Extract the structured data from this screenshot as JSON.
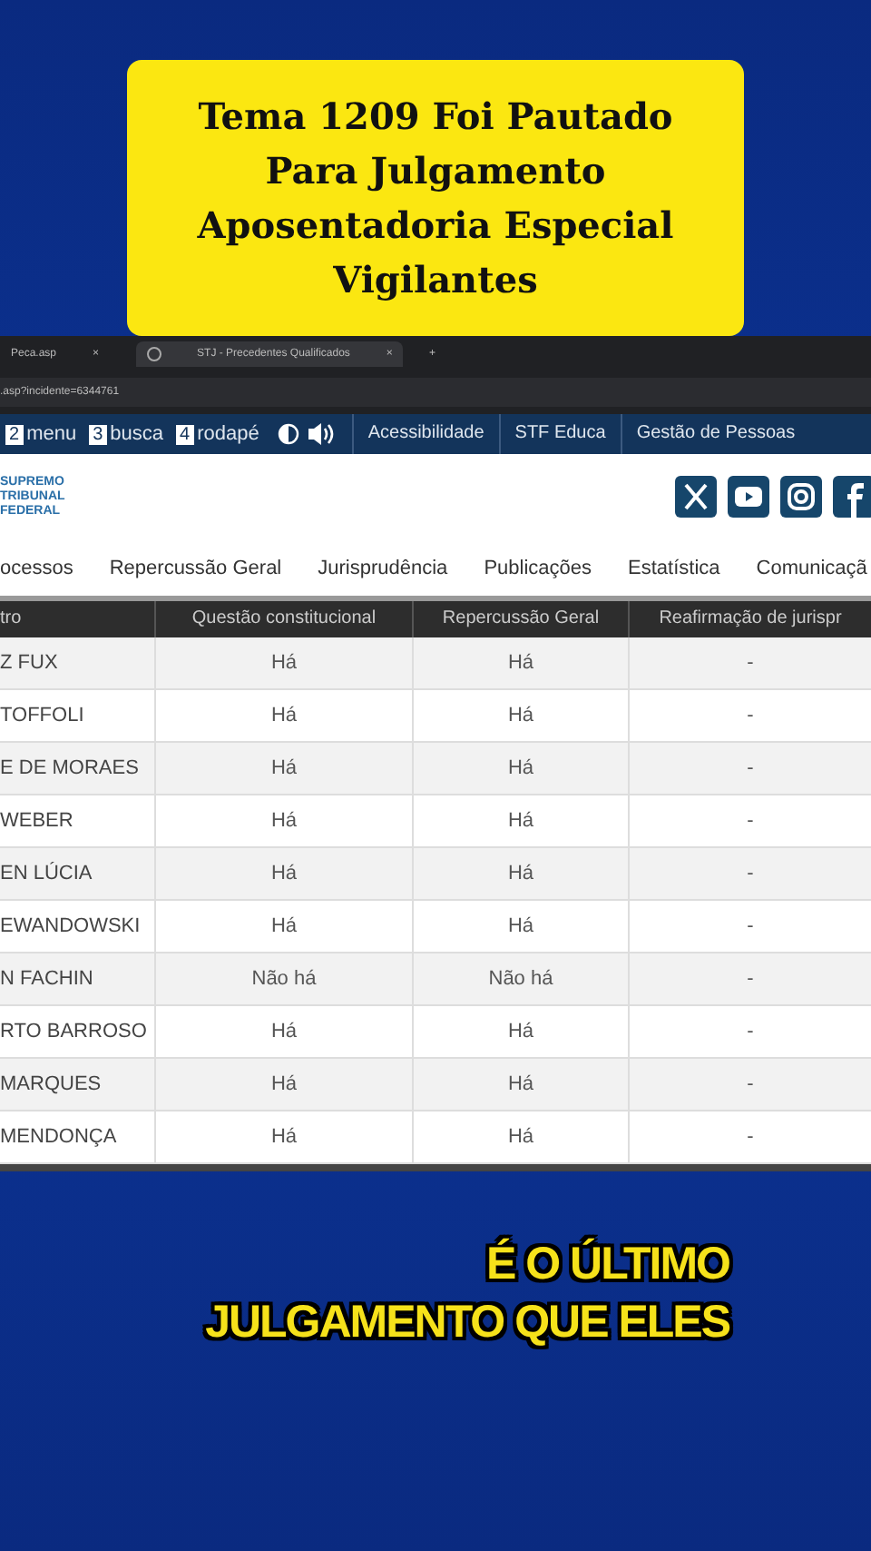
{
  "headline": {
    "lines": [
      "Tema 1209 Foi Pautado",
      "Para Julgamento",
      "Aposentadoria Especial",
      "Vigilantes"
    ]
  },
  "browser": {
    "tabs": [
      {
        "label": "Peca.asp",
        "close": "×",
        "selected": false
      },
      {
        "label": "STJ - Precedentes Qualificados",
        "close": "×",
        "selected": true
      }
    ],
    "new_tab": "+",
    "address": ".asp?incidente=6344761"
  },
  "access_bar": {
    "shortcuts": [
      {
        "key": "2",
        "label": "menu"
      },
      {
        "key": "3",
        "label": "busca"
      },
      {
        "key": "4",
        "label": "rodapé"
      }
    ],
    "links": [
      "Acessibilidade",
      "STF Educa",
      "Gestão de Pessoas"
    ]
  },
  "logo": {
    "lines": [
      "SUPREMO",
      "TRIBUNAL",
      "FEDERAL"
    ]
  },
  "social": [
    {
      "kind": "x"
    },
    {
      "kind": "youtube"
    },
    {
      "kind": "instagram"
    },
    {
      "kind": "facebook"
    }
  ],
  "menu": [
    "ocessos",
    "Repercussão Geral",
    "Jurisprudência",
    "Publicações",
    "Estatística",
    "Comunicaçã"
  ],
  "table": {
    "columns": [
      "tro",
      "Questão constitucional",
      "Repercussão Geral",
      "Reafirmação de jurispr"
    ],
    "rows": [
      [
        "Z FUX",
        "Há",
        "Há",
        "-"
      ],
      [
        "TOFFOLI",
        "Há",
        "Há",
        "-"
      ],
      [
        "E DE MORAES",
        "Há",
        "Há",
        "-"
      ],
      [
        "WEBER",
        "Há",
        "Há",
        "-"
      ],
      [
        "EN LÚCIA",
        "Há",
        "Há",
        "-"
      ],
      [
        "EWANDOWSKI",
        "Há",
        "Há",
        "-"
      ],
      [
        "N FACHIN",
        "Não há",
        "Não há",
        "-"
      ],
      [
        "RTO BARROSO",
        "Há",
        "Há",
        "-"
      ],
      [
        "MARQUES",
        "Há",
        "Há",
        "-"
      ],
      [
        "MENDONÇA",
        "Há",
        "Há",
        "-"
      ]
    ]
  },
  "caption": {
    "lines": [
      "É O ÚLTIMO",
      "JULGAMENTO QUE ELES"
    ]
  }
}
